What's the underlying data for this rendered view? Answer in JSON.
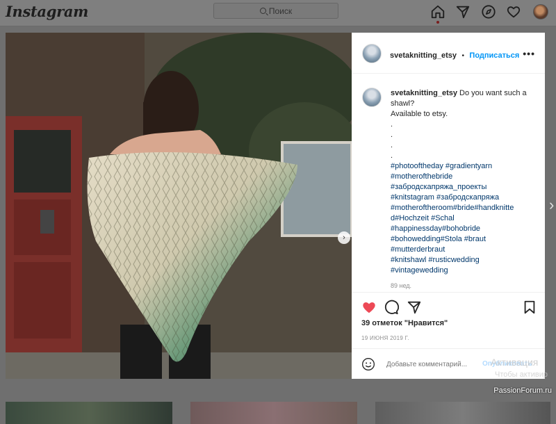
{
  "app": {
    "name": "Instagram"
  },
  "search": {
    "placeholder": "Поиск"
  },
  "nav": {
    "icons": [
      "home-icon",
      "direct-icon",
      "explore-icon",
      "activity-icon",
      "profile-avatar"
    ]
  },
  "post": {
    "username": "svetaknitting_etsy",
    "separator": "•",
    "follow_label": "Подписаться",
    "more_label": "•••",
    "caption_lines": [
      "Do you want such a",
      "shawl?",
      "Available to etsy.",
      ".",
      ".",
      ".",
      "."
    ],
    "hashtag_lines": [
      "#photooftheday #gradientyarn",
      "#motherofthebride",
      "#забродскапряжа_проекты",
      "#knitstagram #забродскапряжа",
      "#motheroftheroom#bride#handknitte",
      "d#Hochzeit #Schal",
      "#happinessday#bohobride",
      "#bohowedding#Stola #braut",
      "#mutterderbraut",
      "#knitshawl #rusticwedding",
      "#vintagewedding"
    ],
    "caption_time": "89 нед.",
    "likes_text": "39 отметок \"Нравится\"",
    "date": "19 ИЮНЯ 2019 Г.",
    "comment_placeholder": "Добавьте комментарий...",
    "publish_label": "Опубликовать",
    "photo_alt": "Woman wearing green gradient lace shawl",
    "carousel": {
      "index": 1,
      "count": 2
    }
  },
  "overlay": {
    "activation_title": "Активация",
    "activation_sub": "Чтобы активир",
    "watermark": "PassionForum.ru"
  },
  "colors": {
    "like": "#ed4956",
    "link": "#00376b",
    "follow": "#0095f6"
  }
}
